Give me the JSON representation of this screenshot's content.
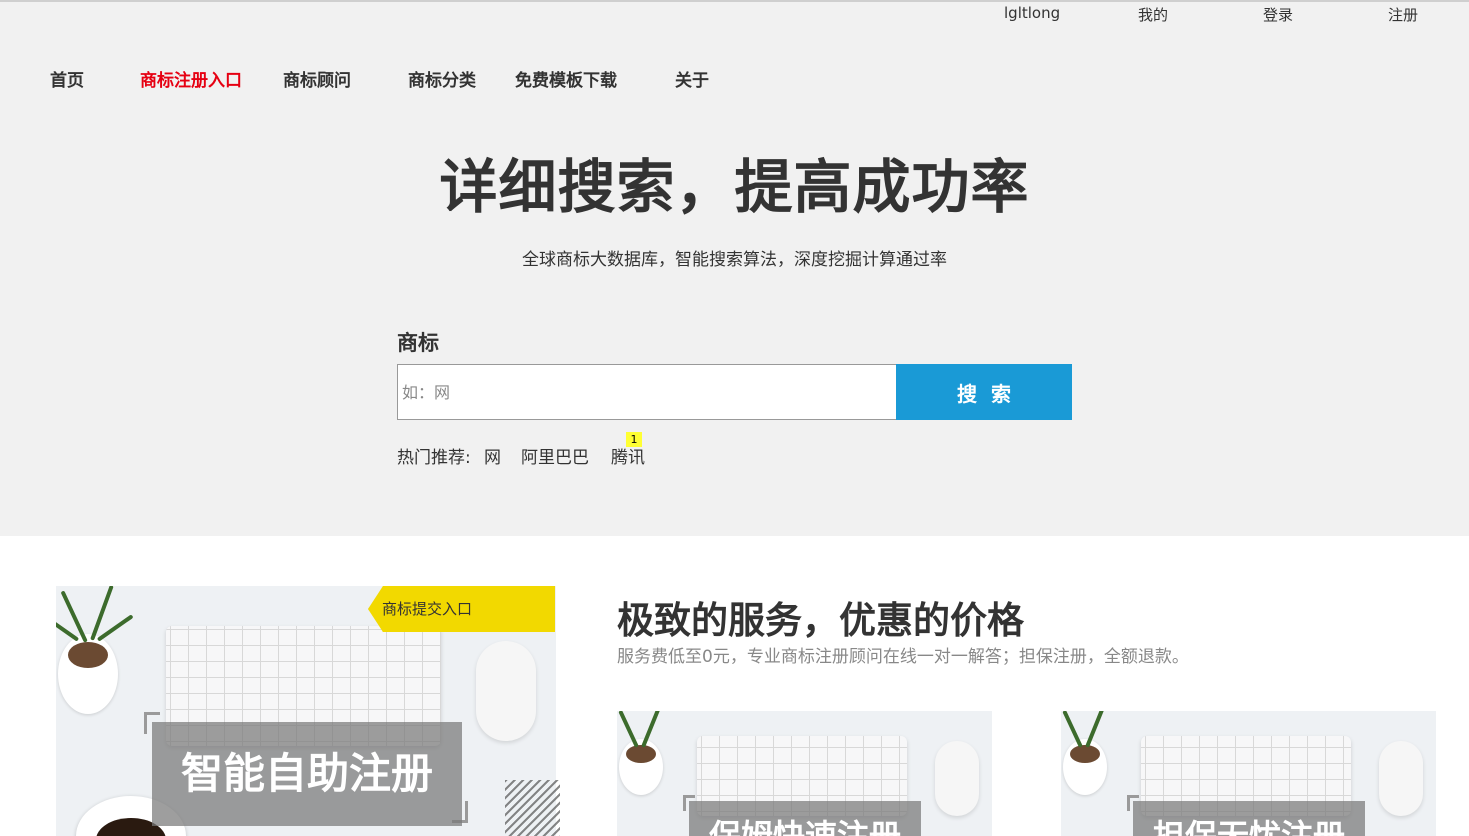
{
  "top_links": {
    "username": "lgltlong",
    "mine": "我的",
    "login": "登录",
    "register": "注册"
  },
  "nav": {
    "items": [
      "首页",
      "商标注册入口",
      "商标顾问",
      "商标分类",
      "免费模板下载",
      "关于"
    ],
    "active_index": 1,
    "active_color": "#e60012"
  },
  "hero": {
    "headline": "详细搜索，提高成功率",
    "subline": "全球商标大数据库，智能搜索算法，深度挖掘计算通过率",
    "background": "#f1f1f1"
  },
  "search": {
    "label": "商标",
    "placeholder": "如：网",
    "value": "",
    "button_label": "搜索",
    "button_color": "#1a9ad6",
    "hot_label": "热门推荐:",
    "hot_items": [
      "网",
      "阿里巴巴",
      "腾讯"
    ],
    "badge_count": "1"
  },
  "services": {
    "title": "极致的服务，优惠的价格",
    "description": "服务费低至0元，专业商标注册顾问在线一对一解答；担保注册，全额退款。",
    "ribbon_label": "商标提交入口",
    "ribbon_color": "#f2d900",
    "cards": [
      "智能自助注册",
      "保姆快速注册",
      "担保无忧注册"
    ]
  }
}
